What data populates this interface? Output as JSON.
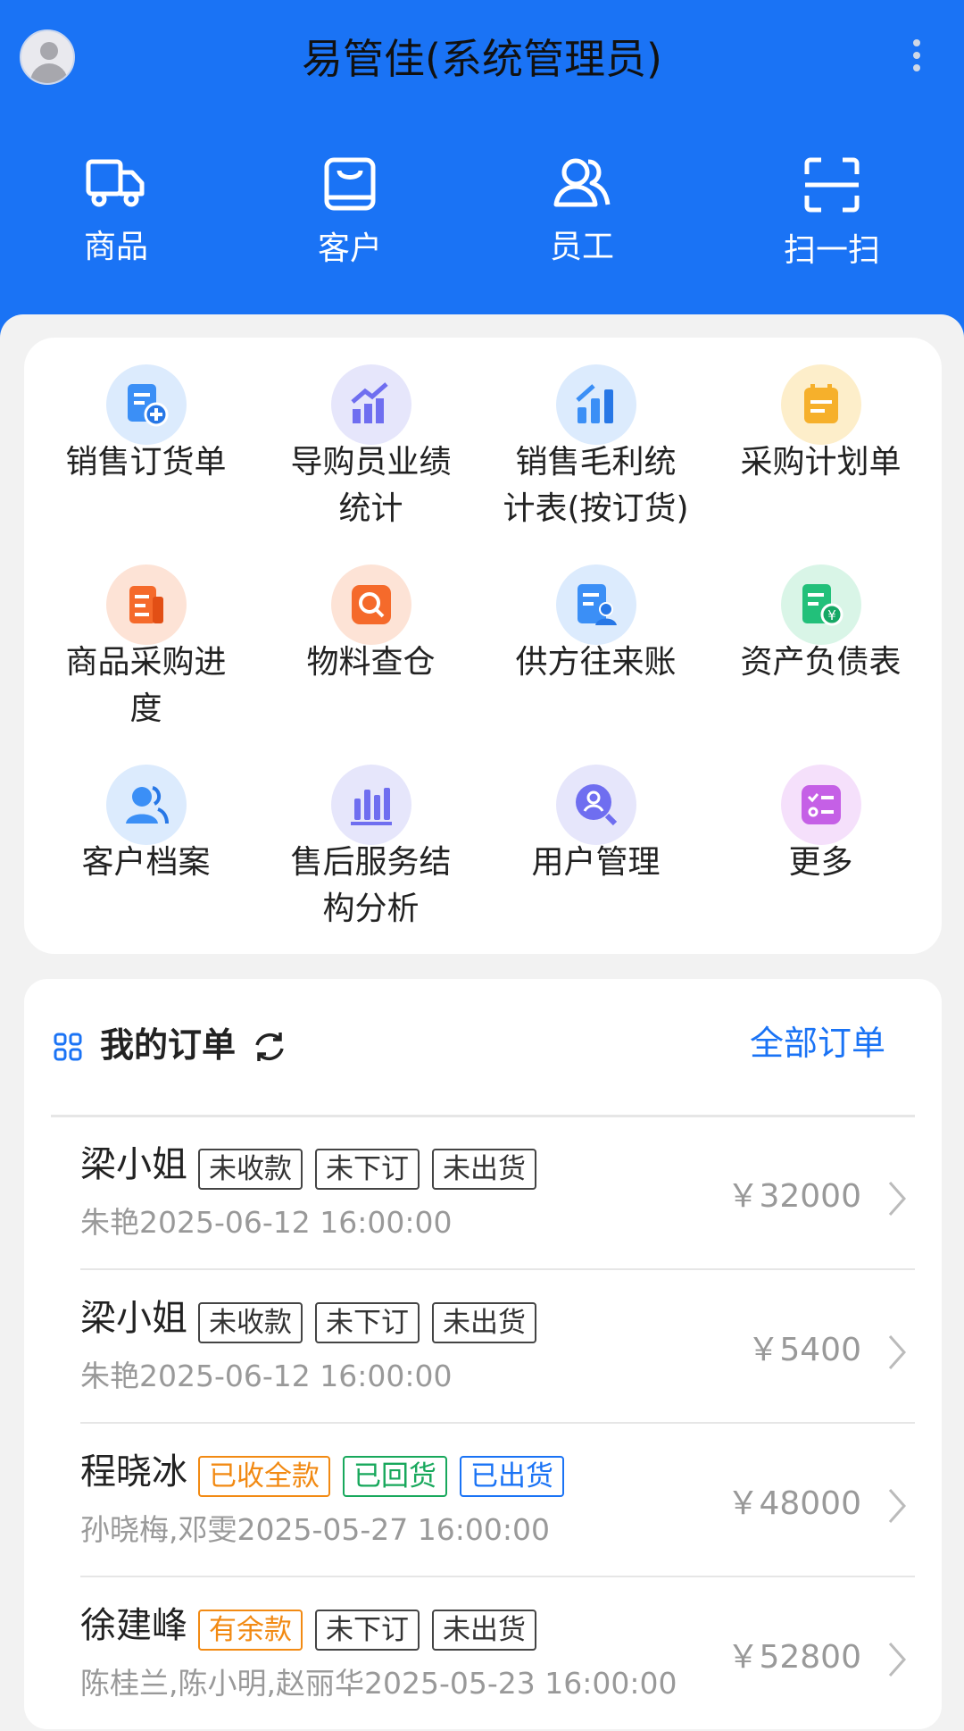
{
  "header": {
    "title": "易管佳(系统管理员)",
    "quick_actions": [
      {
        "label": "商品",
        "icon": "truck-icon"
      },
      {
        "label": "客户",
        "icon": "shopping-bag-icon"
      },
      {
        "label": "员工",
        "icon": "people-icon"
      },
      {
        "label": "扫一扫",
        "icon": "scan-icon"
      }
    ]
  },
  "grid": {
    "items": [
      {
        "label": "销售订货单",
        "icon": "document-add-icon",
        "color": "#3b8ff6"
      },
      {
        "label": "导购员业绩统计",
        "icon": "growth-chart-icon",
        "color": "#6f6ef0"
      },
      {
        "label": "销售毛利统计表(按订货)",
        "icon": "bar-chart-icon",
        "color": "#3b8ff6"
      },
      {
        "label": "采购计划单",
        "icon": "clipboard-icon",
        "color": "#f6b02b"
      },
      {
        "label": "商品采购进度",
        "icon": "report-icon",
        "color": "#f56a2b"
      },
      {
        "label": "物料查仓",
        "icon": "search-box-icon",
        "color": "#f56a2b"
      },
      {
        "label": "供方往来账",
        "icon": "ledger-person-icon",
        "color": "#3b8ff6"
      },
      {
        "label": "资产负债表",
        "icon": "balance-sheet-icon",
        "color": "#22c07a"
      },
      {
        "label": "客户档案",
        "icon": "customers-icon",
        "color": "#3b8ff6"
      },
      {
        "label": "售后服务结构分析",
        "icon": "analysis-chart-icon",
        "color": "#6f6ef0"
      },
      {
        "label": "用户管理",
        "icon": "user-search-icon",
        "color": "#6f6ef0"
      },
      {
        "label": "更多",
        "icon": "more-list-icon",
        "color": "#c560e6"
      }
    ]
  },
  "orders": {
    "title": "我的订单",
    "all_label": "全部订单",
    "rows": [
      {
        "name": "梁小姐",
        "tags": [
          {
            "text": "未收款",
            "style": "gray"
          },
          {
            "text": "未下订",
            "style": "gray"
          },
          {
            "text": "未出货",
            "style": "gray"
          }
        ],
        "sub": "朱艳2025-06-12 16:00:00",
        "amount": "￥32000"
      },
      {
        "name": "梁小姐",
        "tags": [
          {
            "text": "未收款",
            "style": "gray"
          },
          {
            "text": "未下订",
            "style": "gray"
          },
          {
            "text": "未出货",
            "style": "gray"
          }
        ],
        "sub": "朱艳2025-06-12 16:00:00",
        "amount": "￥5400"
      },
      {
        "name": "程晓冰",
        "tags": [
          {
            "text": "已收全款",
            "style": "orange"
          },
          {
            "text": "已回货",
            "style": "green"
          },
          {
            "text": "已出货",
            "style": "blue"
          }
        ],
        "sub": "孙晓梅,邓雯2025-05-27 16:00:00",
        "amount": "￥48000"
      },
      {
        "name": "徐建峰",
        "tags": [
          {
            "text": "有余款",
            "style": "orange"
          },
          {
            "text": "未下订",
            "style": "gray"
          },
          {
            "text": "未出货",
            "style": "gray"
          }
        ],
        "sub": "陈桂兰,陈小明,赵丽华2025-05-23 16:00:00",
        "amount": "￥52800"
      }
    ]
  },
  "colors": {
    "primary": "#1a73f5",
    "orange": "#f28a13",
    "green": "#18a85c"
  }
}
